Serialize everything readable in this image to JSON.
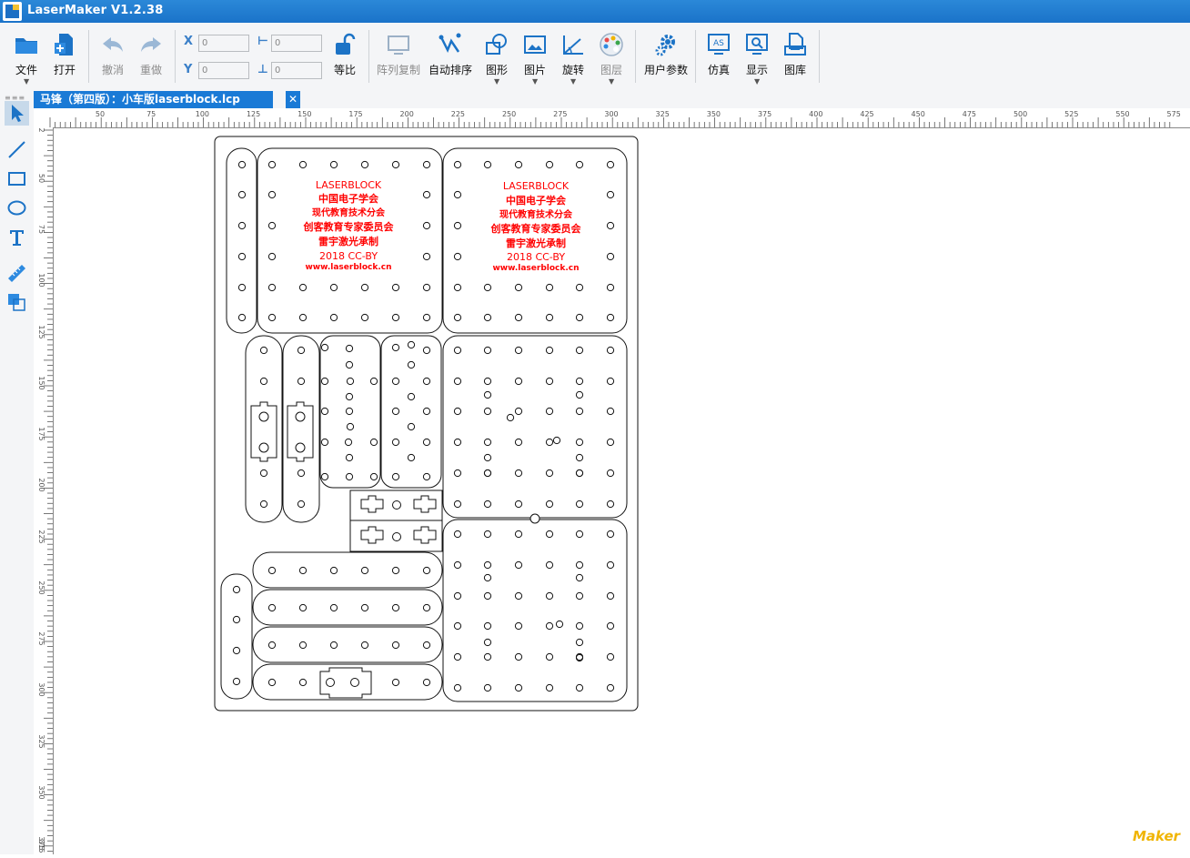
{
  "window": {
    "title": "LaserMaker V1.2.38"
  },
  "toolbar": {
    "file": "文件",
    "open": "打开",
    "undo": "撤消",
    "redo": "重做",
    "x_label": "X",
    "y_label": "Y",
    "w_label": "⊢",
    "h_label": "⊥",
    "x_value": "0",
    "y_value": "0",
    "w_value": "0",
    "h_value": "0",
    "ratio": "等比",
    "array_copy": "阵列复制",
    "auto_arrange": "自动排序",
    "shapes": "图形",
    "image": "图片",
    "rotate": "旋转",
    "layers": "图层",
    "user_params": "用户参数",
    "simulate": "仿真",
    "display": "显示",
    "library": "图库"
  },
  "tab": {
    "title": "马锋（第四版）：小车版laserblock.lcp",
    "close": "✕"
  },
  "ruler": {
    "top_ticks": [
      "50",
      "75",
      "100",
      "125",
      "150",
      "175",
      "200",
      "225",
      "250",
      "275",
      "300",
      "325",
      "350",
      "375",
      "400",
      "425",
      "450",
      "475",
      "500",
      "525",
      "550",
      "575"
    ],
    "left_ticks": [
      "2",
      "50",
      "75",
      "100",
      "125",
      "150",
      "175",
      "200",
      "225",
      "250",
      "275",
      "300",
      "325",
      "350",
      "375",
      "315"
    ]
  },
  "engraving": {
    "left": [
      "LASERBLOCK",
      "中国电子学会",
      "现代教育技术分会",
      "创客教育专家委员会",
      "雷宇激光承制",
      "2018 CC-BY",
      "www.laserblock.cn"
    ],
    "right": [
      "LASERBLOCK",
      "中国电子学会",
      "现代教育技术分会",
      "创客教育专家委员会",
      "雷宇激光承制",
      "2018 CC-BY",
      "www.laserblock.cn"
    ],
    "color": "#ff0000"
  },
  "watermark": "Maker"
}
